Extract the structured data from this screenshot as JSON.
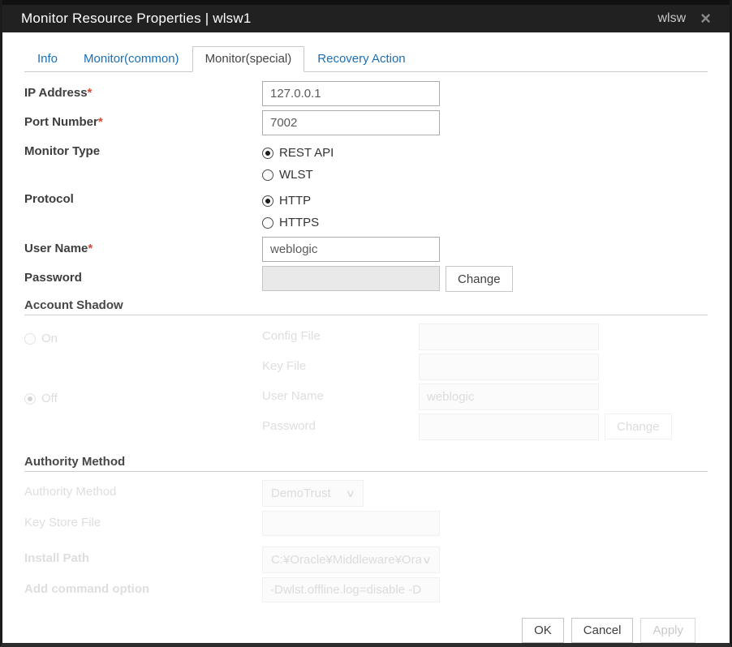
{
  "window": {
    "title": "Monitor Resource Properties | wlsw1",
    "user": "wlsw"
  },
  "icons": {
    "close": "×",
    "chevron_down": "∨"
  },
  "colors": {
    "accent_blue": "#1b6fb5",
    "required_red": "#d14836",
    "titlebar_bg": "#212121"
  },
  "tabs": {
    "items": [
      {
        "label": "Info",
        "active": false
      },
      {
        "label": "Monitor(common)",
        "active": false
      },
      {
        "label": "Monitor(special)",
        "active": true
      },
      {
        "label": "Recovery Action",
        "active": false
      }
    ]
  },
  "form": {
    "ip_address": {
      "label": "IP Address",
      "required": "*",
      "value": "127.0.0.1"
    },
    "port_number": {
      "label": "Port Number",
      "required": "*",
      "value": "7002"
    },
    "monitor_type": {
      "label": "Monitor Type",
      "options": [
        "REST API",
        "WLST"
      ],
      "selected": "REST API"
    },
    "protocol": {
      "label": "Protocol",
      "options": [
        "HTTP",
        "HTTPS"
      ],
      "selected": "HTTP"
    },
    "user_name": {
      "label": "User Name",
      "required": "*",
      "value": "weblogic"
    },
    "password": {
      "label": "Password",
      "value": "",
      "change_label": "Change"
    }
  },
  "account_shadow": {
    "heading": "Account Shadow",
    "on_label": "On",
    "off_label": "Off",
    "selected": "Off",
    "config_file": {
      "label": "Config File",
      "value": ""
    },
    "key_file": {
      "label": "Key File",
      "value": ""
    },
    "user_name": {
      "label": "User Name",
      "value": "weblogic"
    },
    "password": {
      "label": "Password",
      "value": "",
      "change_label": "Change"
    }
  },
  "authority": {
    "heading": "Authority Method",
    "authority_method": {
      "label": "Authority Method",
      "value": "DemoTrust"
    },
    "key_store_file": {
      "label": "Key Store File",
      "value": ""
    }
  },
  "install_path": {
    "label": "Install Path",
    "value": "C:¥Oracle¥Middleware¥Ora"
  },
  "add_command_option": {
    "label": "Add command option",
    "value": "-Dwlst.offline.log=disable -D"
  },
  "footer": {
    "ok": "OK",
    "cancel": "Cancel",
    "apply": "Apply"
  }
}
